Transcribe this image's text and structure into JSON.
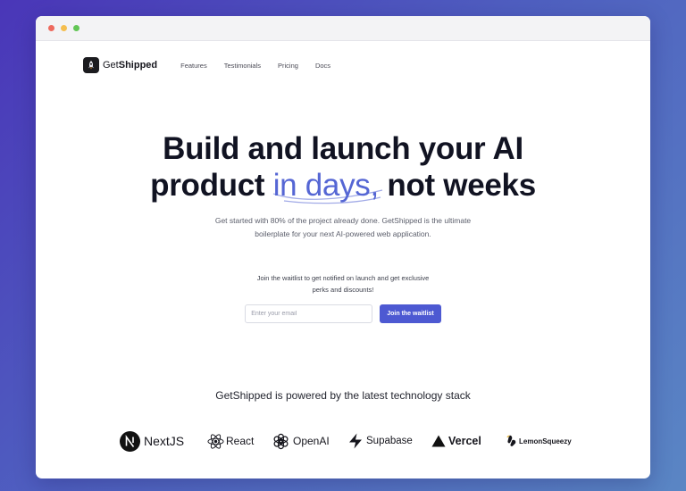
{
  "nav": {
    "brand_prefix": "Get",
    "brand_bold": "Shipped",
    "links": [
      "Features",
      "Testimonials",
      "Pricing",
      "Docs"
    ]
  },
  "hero": {
    "headline_line1": "Build and launch your AI",
    "headline_line2_before": "product ",
    "headline_accent": "in days,",
    "headline_line2_after": " not weeks",
    "subtitle": "Get started with 80% of the project already done. GetShipped is the ultimate boilerplate for your next AI-powered web application."
  },
  "waitlist": {
    "text": "Join the waitlist to get notified on launch and get exclusive perks and discounts!",
    "email_placeholder": "Enter your email",
    "button_label": "Join the waitlist"
  },
  "stack": {
    "title": "GetShipped is powered by the latest technology stack",
    "logos": [
      {
        "name": "NextJS",
        "icon": "nextjs-icon"
      },
      {
        "name": "React",
        "icon": "react-icon"
      },
      {
        "name": "OpenAI",
        "icon": "openai-icon"
      },
      {
        "name": "Supabase",
        "icon": "supabase-icon"
      },
      {
        "name": "Vercel",
        "icon": "vercel-icon"
      },
      {
        "name": "LemonSqueezy",
        "icon": "lemonsqueezy-icon"
      }
    ]
  },
  "colors": {
    "accent": "#5566d4",
    "button": "#4d59d2",
    "headline": "#111322"
  }
}
